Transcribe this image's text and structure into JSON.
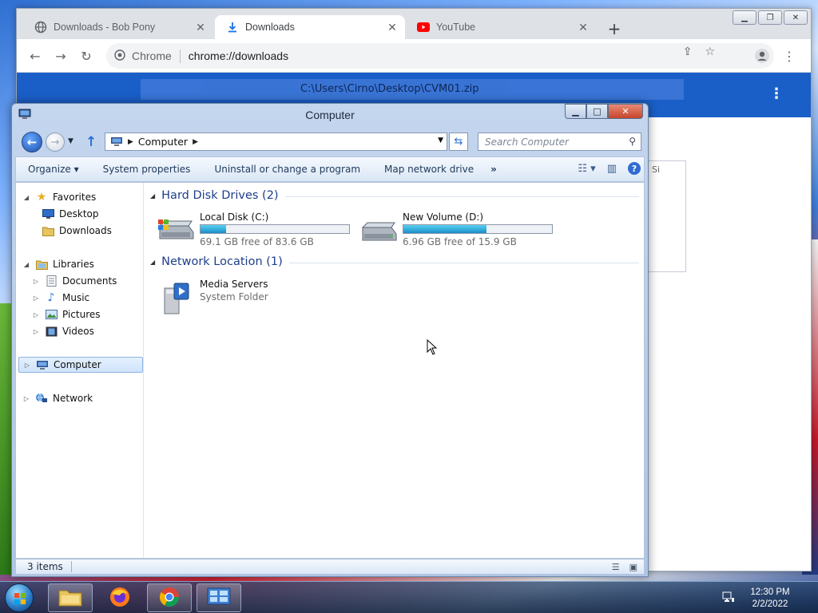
{
  "browser": {
    "tabs": [
      {
        "label": "Downloads - Bob Pony",
        "active": false,
        "favicon": "globe-icon"
      },
      {
        "label": "Downloads",
        "active": true,
        "favicon": "download-icon"
      },
      {
        "label": "YouTube",
        "active": false,
        "favicon": "youtube-icon"
      }
    ],
    "omnibox": {
      "site_chip": "Chrome",
      "url": "chrome://downloads"
    },
    "downloads_page": {
      "blurred_title": "C:\\Users\\Cirno\\Desktop\\CVM01.zip",
      "side_text": "Si"
    }
  },
  "explorer": {
    "title": "Computer",
    "breadcrumb": [
      "Computer"
    ],
    "search_placeholder": "Search Computer",
    "commands": [
      "Organize",
      "System properties",
      "Uninstall or change a program",
      "Map network drive"
    ],
    "more_label": "»",
    "organize_arrow": "▾",
    "nav": {
      "favorites": {
        "label": "Favorites",
        "items": [
          "Desktop",
          "Downloads"
        ]
      },
      "libraries": {
        "label": "Libraries",
        "items": [
          "Documents",
          "Music",
          "Pictures",
          "Videos"
        ]
      },
      "computer": "Computer",
      "network": "Network"
    },
    "groups": {
      "hard_disks": "Hard Disk Drives (2)",
      "network_location": "Network Location (1)"
    },
    "drives": [
      {
        "name": "Local Disk (C:)",
        "free_text": "69.1 GB free of 83.6 GB",
        "used_fraction": 0.17
      },
      {
        "name": "New Volume (D:)",
        "free_text": "6.96 GB free of 15.9 GB",
        "used_fraction": 0.56
      }
    ],
    "network_items": [
      {
        "name": "Media Servers",
        "type": "System Folder"
      }
    ],
    "status": "3 items"
  },
  "taskbar": {
    "apps": [
      "windows-explorer",
      "firefox",
      "chrome",
      "control-panel"
    ],
    "clock_time": "12:30 PM",
    "clock_date": "2/2/2022"
  },
  "colors": {
    "chrome_header": "#1a5fc8",
    "drive_bar": "#26a0da",
    "group_heading": "#1e3e8c"
  }
}
